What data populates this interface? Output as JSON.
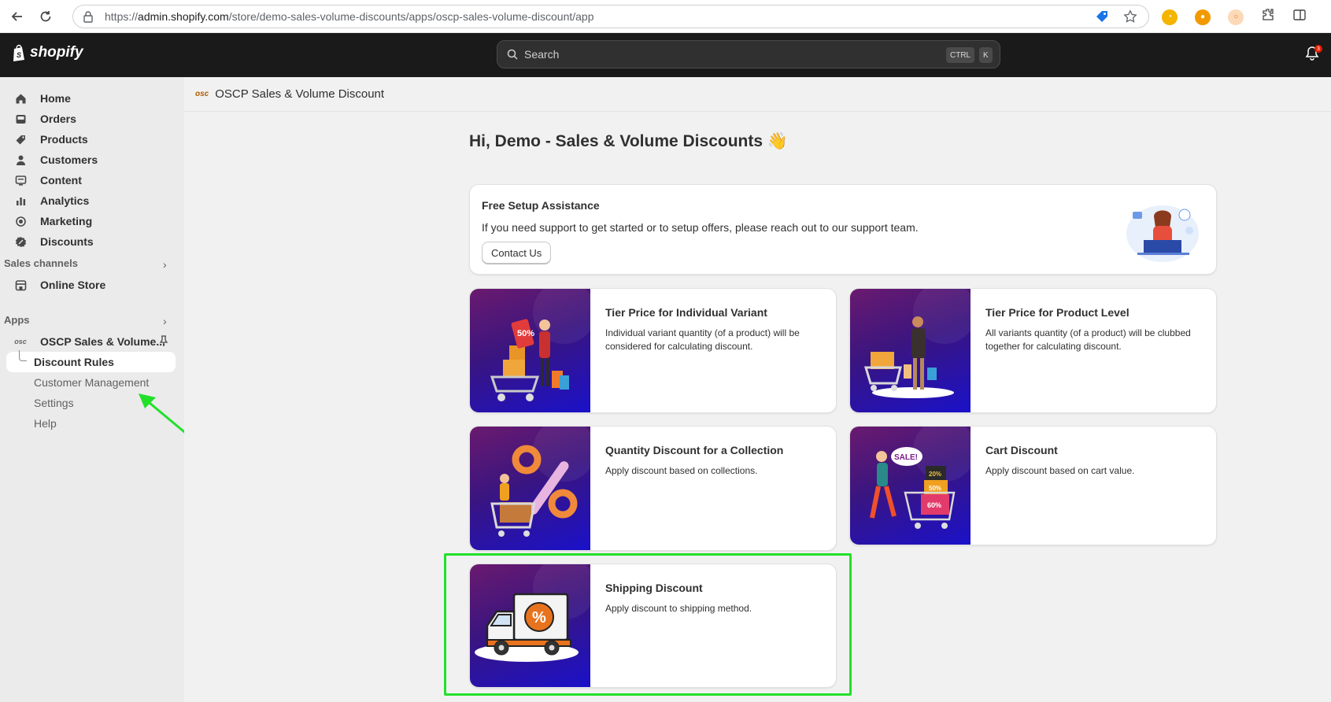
{
  "browser": {
    "url_prefix": "https://",
    "url_host": "admin.shopify.com",
    "url_path": "/store/demo-sales-volume-discounts/apps/oscp-sales-volume-discount/app"
  },
  "topbar": {
    "logo_text": "shopify",
    "search_placeholder": "Search",
    "kbd_ctrl": "CTRL",
    "kbd_k": "K",
    "notification_count": "3"
  },
  "sidebar": {
    "items": [
      {
        "label": "Home",
        "icon": "home-icon"
      },
      {
        "label": "Orders",
        "icon": "inbox-icon"
      },
      {
        "label": "Products",
        "icon": "tag-icon"
      },
      {
        "label": "Customers",
        "icon": "person-icon"
      },
      {
        "label": "Content",
        "icon": "content-icon"
      },
      {
        "label": "Analytics",
        "icon": "bar-chart-icon"
      },
      {
        "label": "Marketing",
        "icon": "target-icon"
      },
      {
        "label": "Discounts",
        "icon": "discount-icon"
      }
    ],
    "sales_channels_label": "Sales channels",
    "online_store_label": "Online Store",
    "apps_label": "Apps",
    "app_name": "OSCP Sales & Volume...",
    "app_sub_items": [
      "Discount Rules",
      "Customer Management",
      "Settings",
      "Help"
    ]
  },
  "app_header": {
    "logo_text": "osc",
    "title": "OSCP Sales & Volume Discount"
  },
  "main": {
    "greeting": "Hi, Demo - Sales & Volume Discounts 👋",
    "setup": {
      "title": "Free Setup Assistance",
      "description": "If you need support to get started or to setup offers, please reach out to our support team.",
      "button": "Contact Us"
    },
    "offers": [
      {
        "title": "Tier Price for Individual Variant",
        "description": "Individual variant quantity (of a product) will be considered for calculating discount."
      },
      {
        "title": "Tier Price for Product Level",
        "description": "All variants quantity (of a product) will be clubbed together for calculating discount."
      },
      {
        "title": "Quantity Discount for a Collection",
        "description": "Apply discount based on collections."
      },
      {
        "title": "Cart Discount",
        "description": "Apply discount based on cart value."
      },
      {
        "title": "Shipping Discount",
        "description": "Apply discount to shipping method."
      }
    ],
    "art_text": {
      "sale": "SALE!",
      "pct_20": "20%",
      "pct_50": "50%",
      "pct_60": "60%",
      "percent_sign": "%"
    }
  },
  "colors": {
    "topbar": "#1a1a1a",
    "highlight": "#22e02a",
    "card_gradient_start": "#6a1a6e",
    "card_gradient_end": "#1a11c9"
  }
}
